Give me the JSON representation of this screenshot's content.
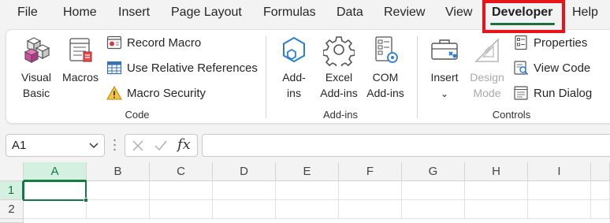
{
  "menu": {
    "tabs": [
      {
        "label": "File"
      },
      {
        "label": "Home"
      },
      {
        "label": "Insert"
      },
      {
        "label": "Page Layout"
      },
      {
        "label": "Formulas"
      },
      {
        "label": "Data"
      },
      {
        "label": "Review"
      },
      {
        "label": "View"
      },
      {
        "label": "Developer"
      },
      {
        "label": "Help"
      }
    ],
    "active_tab": "Developer"
  },
  "ribbon": {
    "code": {
      "label": "Code",
      "visual_basic": {
        "line1": "Visual",
        "line2": "Basic",
        "icon": "visual-basic-icon"
      },
      "macros": {
        "label": "Macros",
        "icon": "macros-icon"
      },
      "record_macro": {
        "label": "Record Macro",
        "icon": "record-macro-icon"
      },
      "use_relative_references": {
        "label": "Use Relative References",
        "icon": "relative-references-icon"
      },
      "macro_security": {
        "label": "Macro Security",
        "icon": "warning-icon"
      }
    },
    "addins": {
      "label": "Add-ins",
      "addins_btn": {
        "line1": "Add-",
        "line2": "ins",
        "icon": "hexagon-icon"
      },
      "excel_addins": {
        "line1": "Excel",
        "line2": "Add-ins",
        "icon": "gear-icon"
      },
      "com_addins": {
        "line1": "COM",
        "line2": "Add-ins",
        "icon": "com-addins-icon"
      }
    },
    "controls": {
      "label": "Controls",
      "insert": {
        "label": "Insert",
        "icon": "toolbox-icon"
      },
      "design_mode": {
        "line1": "Design",
        "line2": "Mode",
        "icon": "design-mode-icon",
        "enabled": false
      },
      "properties": {
        "label": "Properties",
        "icon": "properties-icon"
      },
      "view_code": {
        "label": "View Code",
        "icon": "view-code-icon"
      },
      "run_dialog": {
        "label": "Run Dialog",
        "icon": "run-dialog-icon"
      }
    }
  },
  "formula_bar": {
    "name_box": "A1",
    "formula": ""
  },
  "grid": {
    "columns": [
      "A",
      "B",
      "C",
      "D",
      "E",
      "F",
      "G",
      "H",
      "I"
    ],
    "rows": [
      "1",
      "2"
    ],
    "active_cell": "A1"
  },
  "colors": {
    "accent": "#107c41",
    "highlight": "#e8141c"
  }
}
